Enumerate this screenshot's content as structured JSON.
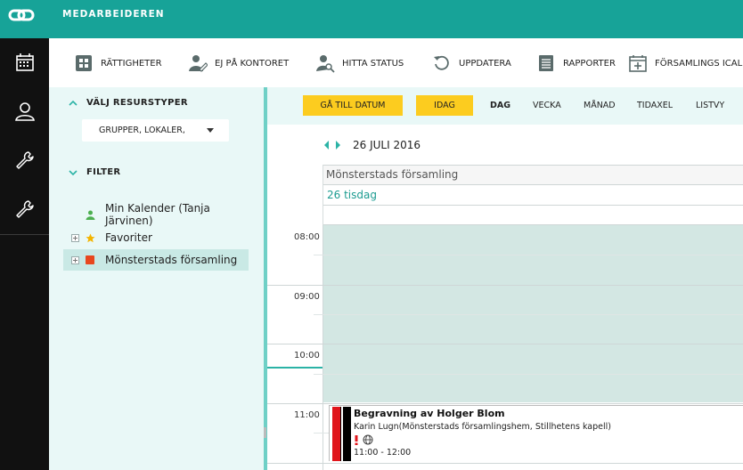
{
  "app": {
    "name": "MEDARBEIDEREN"
  },
  "colors": {
    "brand": "#17a398",
    "accent_yellow": "#fccc1f",
    "sidebar_bg": "#e9f8f7",
    "event_red": "#e0151b"
  },
  "rail": [
    {
      "icon": "calendar-icon"
    },
    {
      "icon": "person-icon"
    },
    {
      "icon": "wrench-icon"
    },
    {
      "icon": "wrench-icon"
    }
  ],
  "toolbar": {
    "items": [
      {
        "label": "RÄTTIGHETER",
        "icon": "grid-icon"
      },
      {
        "label": "EJ PÅ KONTORET",
        "icon": "person-edit-icon"
      },
      {
        "label": "HITTA STATUS",
        "icon": "person-search-icon"
      },
      {
        "label": "UPPDATERA",
        "icon": "refresh-icon"
      },
      {
        "label": "RAPPORTER",
        "icon": "report-icon"
      },
      {
        "label": "FÖRSAMLINGS ICAL",
        "icon": "calendar-add-icon"
      }
    ]
  },
  "sidebar": {
    "resource_section": "VÄLJ RESURSTYPER",
    "resource_select_value": "GRUPPER, LOKALER,",
    "filter_section": "FILTER",
    "calendars": [
      {
        "label": "Min Kalender (Tanja Järvinen)",
        "icon": "person-icon",
        "color": "#4caf50"
      },
      {
        "label": "Favoriter",
        "icon": "star-icon",
        "color": "#f4b400"
      },
      {
        "label": "Mönsterstads församling",
        "icon": "square-icon",
        "color": "#e8471e"
      }
    ]
  },
  "calendar": {
    "goto_date": "GÅ TILL DATUM",
    "today": "IDAG",
    "views": [
      "DAG",
      "VECKA",
      "MÅNAD",
      "TIDAXEL",
      "LISTVY"
    ],
    "active_view": "DAG",
    "date": "26 JULI 2016",
    "resource": "Mönsterstads församling",
    "day": "26 tisdag",
    "hours": [
      "08:00",
      "09:00",
      "10:00",
      "11:00"
    ]
  },
  "event": {
    "title": "Begravning av Holger Blom",
    "subtitle": "Karin Lugn(Mönsterstads församlingshem, Stillhetens kapell)",
    "time": "11:00 - 12:00"
  }
}
